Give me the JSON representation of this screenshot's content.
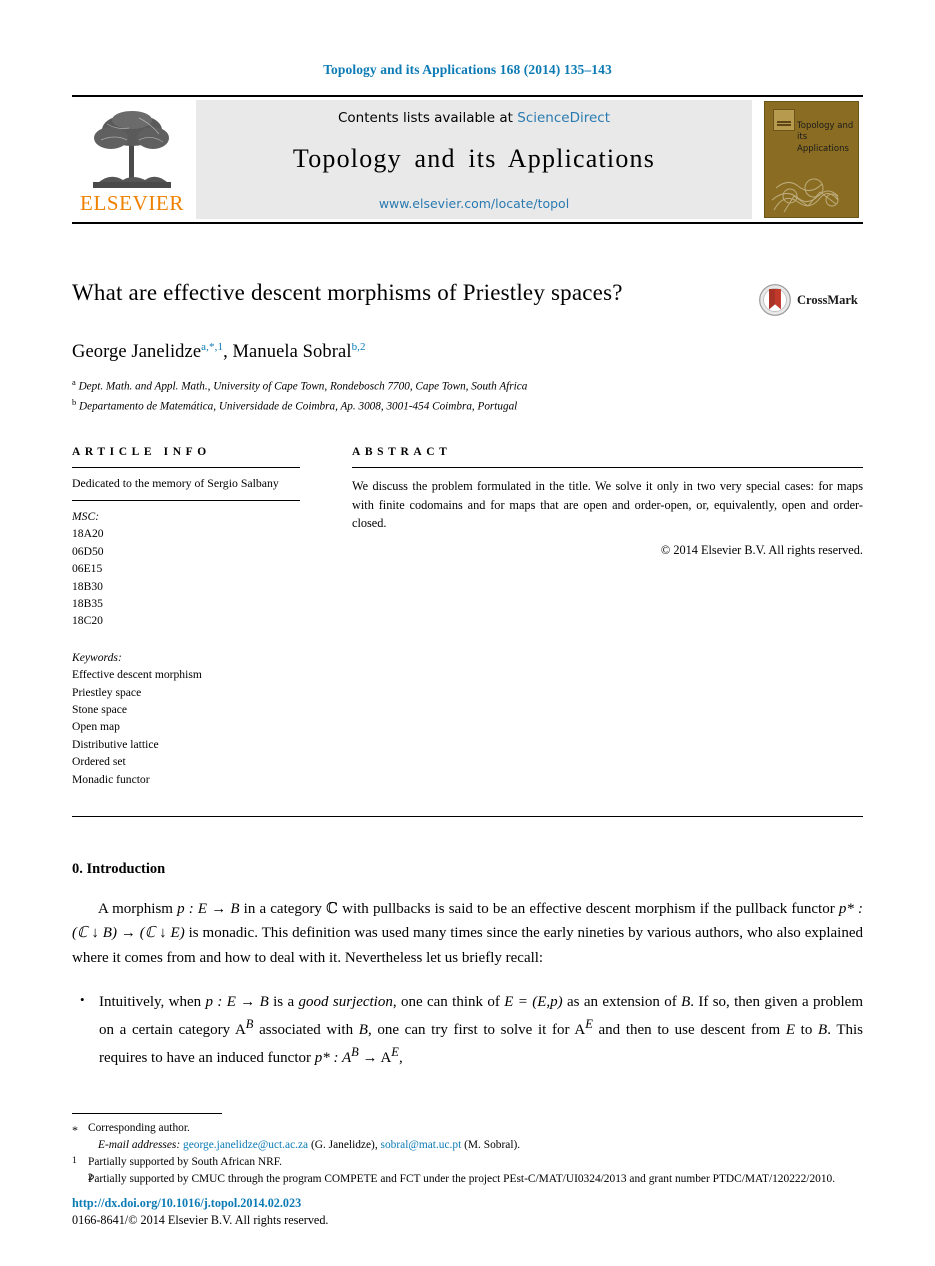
{
  "running_head": "Topology and its Applications 168 (2014) 135–143",
  "banner": {
    "publisher_name": "ELSEVIER",
    "contents_prefix": "Contents lists available at",
    "contents_link": "ScienceDirect",
    "journal_name": "Topology and its Applications",
    "journal_url": "www.elsevier.com/locate/topol",
    "cover_title": "Topology and its Applications"
  },
  "article": {
    "title": "What are effective descent morphisms of Priestley spaces?",
    "authors": "George Janelidze",
    "author1_marks": "a,*,1",
    "authors2": ", Manuela Sobral",
    "author2_marks": "b,2",
    "affiliations": [
      {
        "mark": "a",
        "text": "Dept. Math. and Appl. Math., University of Cape Town, Rondebosch 7700, Cape Town, South Africa"
      },
      {
        "mark": "b",
        "text": "Departamento de Matemática, Universidade de Coimbra, Ap. 3008, 3001-454 Coimbra, Portugal"
      }
    ],
    "crossmark_label": "CrossMark"
  },
  "article_info": {
    "heading": "ARTICLE INFO",
    "dedication": "Dedicated to the memory of Sergio Salbany",
    "msc_label": "MSC:",
    "msc": [
      "18A20",
      "06D50",
      "06E15",
      "18B30",
      "18B35",
      "18C20"
    ],
    "keywords_label": "Keywords:",
    "keywords": [
      "Effective descent morphism",
      "Priestley space",
      "Stone space",
      "Open map",
      "Distributive lattice",
      "Ordered set",
      "Monadic functor"
    ]
  },
  "abstract": {
    "heading": "ABSTRACT",
    "text": "We discuss the problem formulated in the title. We solve it only in two very special cases: for maps with finite codomains and for maps that are open and order-open, or, equivalently, open and order-closed.",
    "copyright": "© 2014 Elsevier B.V. All rights reserved."
  },
  "body": {
    "section_title": "0.  Introduction",
    "para1_a": "A morphism ",
    "para1_math1": "p : E → B",
    "para1_b": " in a category ",
    "para1_math2": "ℂ",
    "para1_c": " with pullbacks is said to be an effective descent morphism if the pullback functor ",
    "para1_math3": "p* : (ℂ ↓ B) → (ℂ ↓ E)",
    "para1_d": " is monadic. This definition was used many times since the early nineties by various authors, who also explained where it comes from and how to deal with it. Nevertheless let us briefly recall:",
    "bullet1_a": "Intuitively, when ",
    "bullet1_math1": "p : E → B",
    "bullet1_b": " is a ",
    "bullet1_em": "good surjection",
    "bullet1_c": ", one can think of ",
    "bullet1_math2": "E = (E,p)",
    "bullet1_d": " as an extension of ",
    "bullet1_math3": "B",
    "bullet1_e": ". If so, then given a problem on a certain category ",
    "bullet1_math4": "A",
    "bullet1_sup4": "B",
    "bullet1_f": " associated with ",
    "bullet1_math5": "B",
    "bullet1_g": ", one can try first to solve it for ",
    "bullet1_math6": "A",
    "bullet1_sup6": "E",
    "bullet1_h": " and then to use descent from ",
    "bullet1_math7": "E",
    "bullet1_i": " to ",
    "bullet1_math8": "B",
    "bullet1_j": ". This requires to have an induced functor ",
    "bullet1_math9": "p* : A",
    "bullet1_sup9": "B",
    "bullet1_k": " → A",
    "bullet1_sup10": "E",
    "bullet1_l": ","
  },
  "footnotes": {
    "corresponding_mark": "*",
    "corresponding": "Corresponding author.",
    "email_label": "E-mail addresses:",
    "email1": "george.janelidze@uct.ac.za",
    "email1_name": "(G. Janelidze),",
    "email2": "sobral@mat.uc.pt",
    "email2_name": "(M. Sobral).",
    "fn1_mark": "1",
    "fn1": "Partially supported by South African NRF.",
    "fn2_mark": "2",
    "fn2": "Partially supported by CMUC through the program COMPETE and FCT under the project PEst-C/MAT/UI0324/2013 and grant number PTDC/MAT/120222/2010."
  },
  "footer": {
    "doi": "http://dx.doi.org/10.1016/j.topol.2014.02.023",
    "issn_line": "0166-8641/© 2014 Elsevier B.V. All rights reserved."
  },
  "colors": {
    "link": "#0b7ab5",
    "elsevier_orange": "#f08000",
    "banner_grey": "#e9e9e9",
    "cover_brown": "#8a6d22",
    "crossmark_red": "#c0392b"
  }
}
